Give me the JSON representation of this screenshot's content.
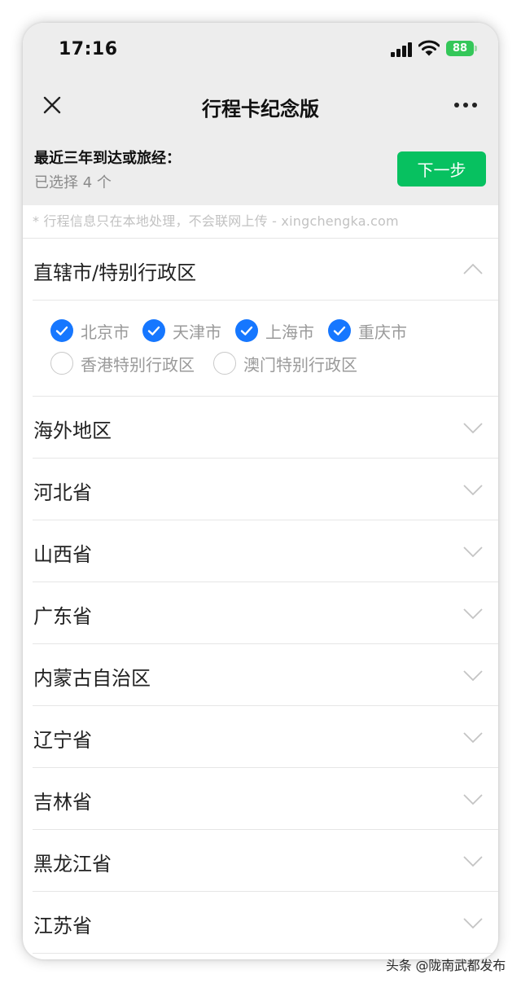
{
  "status_bar": {
    "time": "17:16",
    "battery": "88"
  },
  "nav": {
    "title": "行程卡纪念版"
  },
  "selection": {
    "title": "最近三年到达或旅经：",
    "count_text": "已选择 4 个",
    "next_label": "下一步"
  },
  "notice": "* 行程信息只在本地处理，不会联网上传 - xingchengka.com",
  "expanded_region": {
    "title": "直辖市/特别行政区",
    "options": [
      {
        "label": "北京市",
        "checked": true
      },
      {
        "label": "天津市",
        "checked": true
      },
      {
        "label": "上海市",
        "checked": true
      },
      {
        "label": "重庆市",
        "checked": true
      },
      {
        "label": "香港特别行政区",
        "checked": false
      },
      {
        "label": "澳门特别行政区",
        "checked": false
      }
    ]
  },
  "regions": [
    "海外地区",
    "河北省",
    "山西省",
    "广东省",
    "内蒙古自治区",
    "辽宁省",
    "吉林省",
    "黑龙江省",
    "江苏省"
  ],
  "colors": {
    "accent_green": "#07c160",
    "check_blue": "#1677ff"
  },
  "watermark": "头条 @陇南武都发布"
}
